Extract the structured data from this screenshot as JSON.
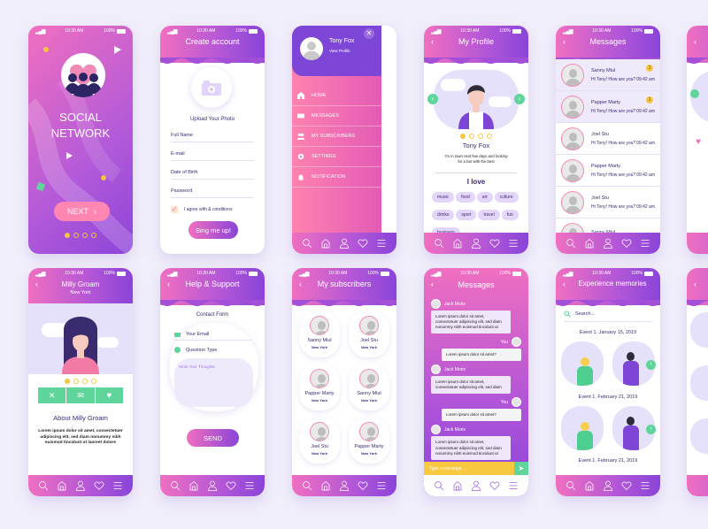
{
  "status_bar": {
    "time": "10:30 AM",
    "battery": "100%"
  },
  "splash": {
    "title_line1": "SOCIAL",
    "title_line2": "NETWORK",
    "next_label": "NEXT",
    "page_index": 1,
    "page_count": 4
  },
  "create_account": {
    "title": "Create account",
    "upload_label": "Upload Your Photo",
    "fields": [
      "Full Name",
      "E-mail",
      "Date of Birth",
      "Password"
    ],
    "agree_label": "I agree with & conditions",
    "agree_checked": true,
    "submit_label": "Sing me up!"
  },
  "menu": {
    "user_name": "Tony Fox",
    "view_profile": "View Profile",
    "items": [
      {
        "label": "HOME",
        "icon": "home-icon"
      },
      {
        "label": "MESSAGES",
        "icon": "mail-icon"
      },
      {
        "label": "MY SUBSCRIBERS",
        "icon": "users-icon"
      },
      {
        "label": "SETTINGS",
        "icon": "gear-icon"
      },
      {
        "label": "NOTIFICATION",
        "icon": "bell-icon"
      }
    ]
  },
  "profile": {
    "title": "My Profile",
    "name": "Tony Fox",
    "bio": "I'm in town next few days and looking for a bar with the best",
    "love_title": "I love",
    "tags": [
      "music",
      "food",
      "art",
      "culture",
      "drinks",
      "sport",
      "travel",
      "fun",
      "business"
    ],
    "page_index": 1,
    "page_count": 4
  },
  "messages": {
    "title": "Messages",
    "items": [
      {
        "name": "Sanny Miul",
        "text": "Hi Tony! How are you?",
        "time": "09:42 am",
        "badge": "1"
      },
      {
        "name": "Papper Marty",
        "text": "Hi Tony! How are you?",
        "time": "09:42 am",
        "badge": "2"
      },
      {
        "name": "Joel Stu",
        "text": "Hi Tony! How are you?",
        "time": "09:42 am",
        "badge": ""
      },
      {
        "name": "Papper Marty",
        "text": "Hi Tony! How are you?",
        "time": "09:42 am",
        "badge": ""
      },
      {
        "name": "Joel Stu",
        "text": "Hi Tony! How are you?",
        "time": "09:42 am",
        "badge": ""
      },
      {
        "name": "Sanny Miul",
        "text": "",
        "time": "",
        "badge": ""
      }
    ]
  },
  "user_detail": {
    "name": "Milly Groam",
    "city": "New York",
    "about_title": "About Milly Groam",
    "about_text": "Lorem ipsum dolor sit amet, consectetuer adipiscing elit, sed diam nonummy nibh euismod tincidunt ut laoreet dolore",
    "page_index": 1,
    "page_count": 4
  },
  "help": {
    "title": "Help & Support",
    "form_title": "Contact Form",
    "email_label": "Your Email",
    "question_label": "Question Type",
    "thoughts_placeholder": "Write Your Thoughts",
    "send_label": "SEND"
  },
  "subscribers": {
    "title": "My subscribers",
    "items": [
      {
        "name": "Sanny Miul",
        "city": "New York"
      },
      {
        "name": "Joel Stu",
        "city": "New York"
      },
      {
        "name": "Papper Marty",
        "city": "New York"
      },
      {
        "name": "Sanny Miul",
        "city": "New York"
      },
      {
        "name": "Joel Stu",
        "city": "New York"
      },
      {
        "name": "Papper Marty",
        "city": "New York"
      }
    ]
  },
  "chat": {
    "title": "Messages",
    "messages": [
      {
        "from": "Jack Moris",
        "you": false,
        "text": "Lorem ipsum dolor sit amet, consectetuer adipiscing elit, sed diam nonummy nibh euismod tincidunt ut"
      },
      {
        "from": "You",
        "you": true,
        "text": "Lorem ipsum dolor sit amet?"
      },
      {
        "from": "Jack Moris",
        "you": false,
        "text": "Lorem ipsum dolor sit amet, consectetuer adipiscing elit, sed diam"
      },
      {
        "from": "You",
        "you": true,
        "text": "Lorem ipsum dolor sit amet?"
      },
      {
        "from": "Jack Moris",
        "you": false,
        "text": "Lorem ipsum dolor sit amet, consectetuer adipiscing elit, sed diam nonummy nibh euismod tincidunt ut"
      }
    ],
    "input_placeholder": "Type a message ..."
  },
  "memories": {
    "title": "Experience memories",
    "search_placeholder": "Search...",
    "events": [
      "Event 1. January 15, 2019",
      "Event 1. February 21, 2019",
      "Event 1. February 21, 2019"
    ]
  },
  "colors": {
    "accent": "#b35ad9",
    "pink": "#f06fc0",
    "purple": "#8d45d9",
    "green": "#5fd49b",
    "yellow": "#f5c542",
    "text": "#3c2a74"
  }
}
